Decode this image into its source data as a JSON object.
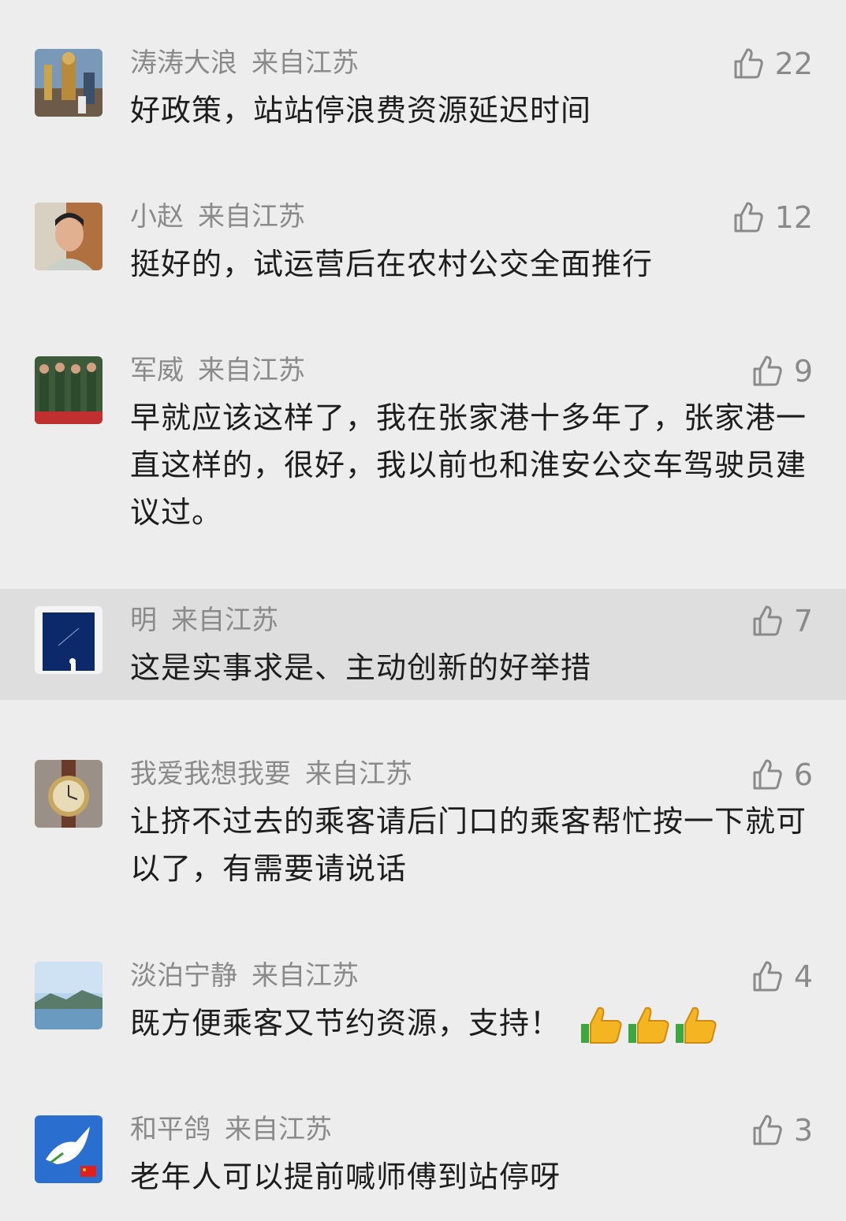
{
  "comments": [
    {
      "user": "涛涛大浪",
      "location": "来自江苏",
      "likes": "22",
      "text": "好政策，站站停浪费资源延迟时间",
      "avatar_icon": "monument-photo"
    },
    {
      "user": "小赵",
      "location": "来自江苏",
      "likes": "12",
      "text": "挺好的，试运营后在农村公交全面推行",
      "avatar_icon": "person-photo"
    },
    {
      "user": "军威",
      "location": "来自江苏",
      "likes": "9",
      "text": "早就应该这样了，我在张家港十多年了，张家港一直这样的，很好，我以前也和淮安公交车驾驶员建议过。",
      "avatar_icon": "soldiers-photo"
    },
    {
      "user": "明",
      "location": "来自江苏",
      "likes": "7",
      "text": "这是实事求是、主动创新的好举措",
      "avatar_icon": "night-sky-image"
    },
    {
      "user": "我爱我想我要",
      "location": "来自江苏",
      "likes": "6",
      "text": "让挤不过去的乘客请后门口的乘客帮忙按一下就可以了，有需要请说话",
      "avatar_icon": "pocket-watch-photo"
    },
    {
      "user": "淡泊宁静",
      "location": "来自江苏",
      "likes": "4",
      "text": "既方便乘客又节约资源，支持！",
      "avatar_icon": "lake-landscape-photo",
      "emojis": [
        "thumbs-up-emoji",
        "thumbs-up-emoji",
        "thumbs-up-emoji"
      ]
    },
    {
      "user": "和平鸽",
      "location": "来自江苏",
      "likes": "3",
      "text": "老年人可以提前喊师傅到站停呀",
      "avatar_icon": "peace-dove-image"
    }
  ],
  "colors": {
    "background": "#ededed",
    "highlight": "#dedede",
    "meta_text": "#8a8a8a",
    "body_text": "#1d1d1d"
  }
}
